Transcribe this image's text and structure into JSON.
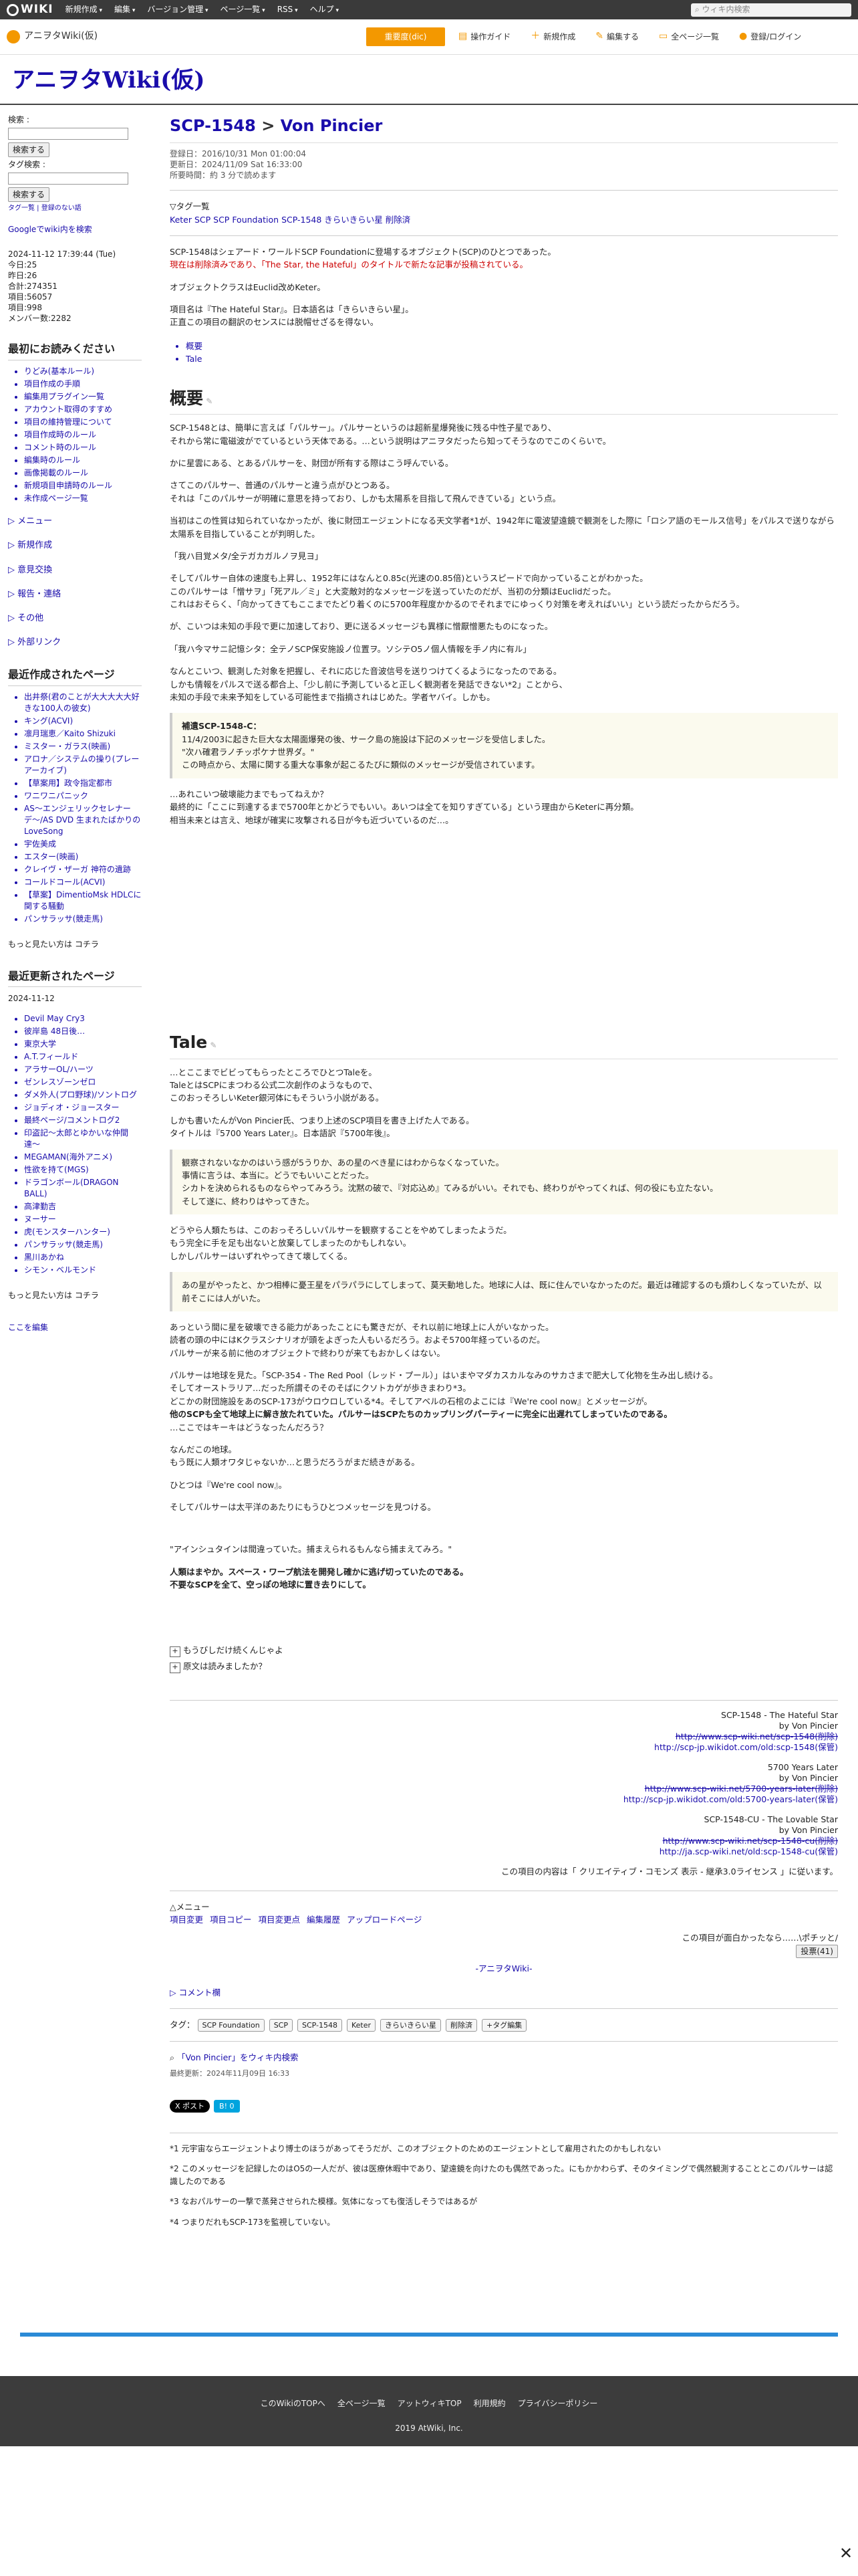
{
  "topbar": {
    "logo": "WIKI",
    "menu": [
      "新規作成",
      "編集",
      "バージョン管理",
      "ページ一覧",
      "RSS",
      "ヘルプ"
    ],
    "search": "ウィキ内検索"
  },
  "toolbar": {
    "site": "アニヲタWiki(仮)",
    "items": [
      "重要度(dic)",
      "操作ガイド",
      "新規作成",
      "編集する",
      "全ページ一覧",
      "登録/ログイン"
    ]
  },
  "site_title": "アニヲタWiki(仮)",
  "left": {
    "search_label": "検索 :",
    "search_btn": "検索する",
    "tag_label": "タグ検索 :",
    "tag_btn": "検索する",
    "tag_links": "タグ一覧 | 登録のない語",
    "google": "Googleでwiki内を検索",
    "stats": [
      "2024-11-12 17:39:44 (Tue)",
      "今日:25",
      "昨日:26",
      "合計:274351",
      "項目:56057",
      "項目:998",
      "メンバー数:2282"
    ],
    "recent_title": "最初にお読みください",
    "recent": [
      "りどみ(基本ルール)",
      "項目作成の手順",
      "編集用プラグイン一覧",
      "アカウント取得のすすめ",
      "項目の維持管理について",
      "項目作成時のルール",
      "コメント時のルール",
      "編集時のルール",
      "画像掲載のルール",
      "新規項目申請時のルール",
      "未作成ページ一覧"
    ],
    "menus": [
      "メニュー",
      "新規作成",
      "意見交換",
      "報告・連絡",
      "その他",
      "外部リンク"
    ],
    "created_title": "最近作成されたページ",
    "created": [
      "出井祭(君のことが大大大大大好きな100人の彼女)",
      "キング(ACVI)",
      "凛月瑞恵／Kaito Shizuki",
      "ミスター・ガラス(映画)",
      "アロナ／システムの操り(プレーアーカイブ)",
      "【草案用】政令指定都市",
      "ワニワニパニック",
      "AS〜エンジェリックセレナーデ〜/AS DVD 生まれたばかりのLoveSong",
      "宇佐美成",
      "エスター(映画)",
      "クレイヴ・ザーガ 神符の遺跡",
      "コールドコール(ACVI)",
      "【草案】DimentioMsk HDLCに関する騒動",
      "パンサラッサ(競走馬)"
    ],
    "more1": "もっと見たい方は コチラ",
    "updated_title": "最近更新されたページ",
    "date": "2024-11-12",
    "updated": [
      "Devil May Cry3",
      "彼岸島 48日後…",
      "東京大学",
      "A.T.フィールド",
      "アラサーOL/ハーツ",
      "ゼンレスゾーンゼロ",
      "ダメ外人(プロ野球)/ソントログ",
      "ジョディオ・ジョースター",
      "最終ページ/コメントログ2",
      "印盗記〜太郎とゆかいな仲間達〜",
      "MEGAMAN(海外アニメ)",
      "性欲を持て(MGS)",
      "ドラゴンボール(DRAGON BALL)",
      "高津勤吉",
      "ヌーサー",
      "虎(モンスターハンター)",
      "パンサラッサ(競走馬)",
      "黒川あかね",
      "シモン・ベルモンド"
    ],
    "more2": "もっと見たい方は コチラ",
    "edit_here": "ここを編集"
  },
  "main": {
    "title_a": "SCP-1548",
    "title_sep": ">",
    "title_b": "Von Pincier",
    "meta": [
      "登録日：2016/10/31 Mon 01:00:04",
      "更新日：2024/11/09 Sat 16:33:00",
      "所要時間：約 3 分で読めます"
    ],
    "tags_label": "▽タグ一覧",
    "tags_line": "Keter SCP SCP Foundation SCP-1548 きらいきらい星 削除済",
    "intro1": "SCP-1548はシェアード・ワールドSCP Foundationに登場するオブジェクト(SCP)のひとつであった。",
    "intro2": "現在は削除済みであり、「The Star, the Hateful」のタイトルで新たな記事が投稿されている。",
    "intro3": "オブジェクトクラスはEuclid改めKeter。",
    "intro4": "項目名は『The Hateful Star』。日本語名は「きらいきらい星」。",
    "intro5": "正直この項目の翻訳のセンスには脱帽せざるを得ない。",
    "toc": [
      "概要",
      "Tale"
    ],
    "h_gaiyou": "概要",
    "g1": "SCP-1548とは、簡単に言えば「パルサー」。パルサーというのは超新星爆発後に残る中性子星であり、",
    "g2": "それから常に電磁波がでているという天体である。…という説明はアニヲタだったら知ってそうなのでこのくらいで。",
    "g3": "かに星雲にある、とあるパルサーを、財団が所有する際はこう呼んでいる。",
    "g4": "さてこのパルサー、普通のパルサーと違う点がひとつある。",
    "g5": "それは「このパルサーが明確に意思を持っており、しかも太陽系を目指して飛んできている」という点。",
    "g6": "当初はこの性質は知られていなかったが、後に財団エージェントになる天文学者*1が、1942年に電波望遠鏡で観測をした際に「ロシア語のモールス信号」をパルスで送りながら太陽系を目指していることが判明した。",
    "g7": "「我ハ目覚メタ/全テガカガルノヲ見ヨ」",
    "g8": "そしてパルサー自体の速度も上昇し、1952年にはなんと0.85c(光速の0.85倍)というスピードで向かっていることがわかった。",
    "g9": "このパルサーは「憎サヲ」「死アル／ミ」と大変敵対的なメッセージを送っていたのだが、当初の分類はEuclidだった。",
    "g10": "これはおそらく、「向かってきてもここまでたどり着くのに5700年程度かかるのでそれまでにゆっくり対策を考えればいい」という読だったからだろう。",
    "g11": "が、こいつは未知の手段で更に加速しており、更に送るメッセージも異様に憎厭憎悪たものになった。",
    "g12": "「我ハ今マサニ記憶シタ：全テノSCP保安施設ノ位置ヲ。ソシテO5ノ個人情報を手ノ内に有ル」",
    "g13": "なんとこいつ、観測した対象を把握し、それに応じた音波信号を送りつけてくるようになったのである。",
    "g14": "しかも情報をパルスで送る都合上、「少し前に予測していると正しく観測者を発話できない*2」ことから、",
    "g15": "未知の手段で未来予知をしている可能性まで指摘されはじめた。学者ヤバイ。しかも。",
    "box_title": "補遺SCP-1548-C：",
    "box1": "11/4/2003に起きた巨大な太陽面爆発の後、サーク島の施設は下記のメッセージを受信しました。",
    "box2": "\"次ハ確君ラノチッポケナ世界ダ。\"",
    "box3": "この時点から、太陽に関する重大な事象が起こるたびに類似のメッセージが受信されています。",
    "g16": "…あれこいつ破壊能力までもってねえか？",
    "g17": "最終的に「ここに到達するまで5700年とかどうでもいい。あいつは全てを知りすぎている」という理由からKeterに再分類。",
    "g18": "相当未来とは言え、地球が確実に攻撃される日が今も近づいているのだ…。",
    "h_tale": "Tale",
    "t1": "…とここまでビビってもらったところでひとつTaleを。",
    "t2": "TaleとはSCPにまつわる公式二次創作のようなもので、",
    "t3": "このおっそろしいKeter銀河体にもそういう小説がある。",
    "t4": "しかも書いたんがVon Pincier氏、つまり上述のSCP項目を書き上げた人である。",
    "t5": "タイトルは『5700 Years Later』。日本語訳『5700年後』。",
    "qb1": "観察されないなかのはいう感が5うりか、あの星のべき星にはわからなくなっていた。",
    "qb2": "事情に言うは、本当に。どうでもいいことだった。",
    "qb3": "シカトを決められるものならやってみろう。沈黙の破で、『対応込め』てみるがいい。それでも、終わりがやってくれば、何の役にも立たない。",
    "qb4": "そして遂に、終わりはやってきた。",
    "t6": "どうやら人類たちは、このおっそろしいパルサーを観察することをやめてしまったようだ。",
    "t7": "もう完全に手を足も出ないと放棄してしまったのかもしれない。",
    "t8": "しかしパルサーはいずれやってきて壊してくる。",
    "qc1": "あの星がやったと、かつ相棒に憂王星をパラパラにしてしまって、莫天動地した。地球に人は、既に住んでいなかったのだ。最近は確認するのも煩わしくなっていたが、以前そこには人がいた。",
    "t9": "あっという間に星を破壊できる能力があったことにも驚きだが、それ以前に地球上に人がいなかった。",
    "t10": "読者の頭の中にはKクラスシナリオが頭をよぎった人もいるだろう。およそ5700年経っているのだ。",
    "t11": "パルサーが来る前に他のオブジェクトで終わりが来てもおかしくはない。",
    "t12": "パルサーは地球を見た。「SCP-354 - The Red Pool（レッド・プール）」はいまやマダカスカルなみのサカさまで肥大して化物を生み出し続ける。",
    "t13": "そしてオーストラリア…だった所謂そのそのそばにクソトカゲが歩きまわり*3。",
    "t14": "どこかの財団施設をあのSCP-173がウロウロしている*4。そしてアベルの石棺のよこには『We're cool now』とメッセージが。",
    "t15": "他のSCPも全て地球上に解き放たれていた。パルサーはSCPたちのカップリングパーティーに完全に出遅れてしまっていたのである。",
    "t16": "…ここではキーキはどうなったんだろう？",
    "t17": "なんだこの地球。",
    "t18": "もう既に人類オワタじゃないか…と思うだろうがまだ続きがある。",
    "t19": "ひとつは『We're cool now』。",
    "t20": "そしてパルサーは太平洋のあたりにもうひとつメッセージを見つける。",
    "t21": "\"アインシュタインは間違っていた。捕まえられるもんなら捕まえてみろ。\"",
    "t22": "人類はまやか。スペース・ワープ航法を開発し確かに逃げ切っていたのである。",
    "t23": "不要なSCPを全て、空っぽの地球に置き去りにして。",
    "folds": [
      "もうびしだけ続くんじゃよ",
      "原文は読みましたか？"
    ],
    "credits": [
      [
        "SCP-1548 - The Hateful Star",
        "by Von Pincier",
        "http://www.scp-wiki.net/scp-1548(削除)",
        "http://scp-jp.wikidot.com/old:scp-1548(保管)"
      ],
      [
        "5700 Years Later",
        "by Von Pincier",
        "http://www.scp-wiki.net/5700-years-later(削除)",
        "http://scp-jp.wikidot.com/old:5700-years-later(保管)"
      ],
      [
        "SCP-1548-CU - The Lovable Star",
        "by Von Pincier",
        "http://www.scp-wiki.net/scp-1548-cu(削除)",
        "http://ja.scp-wiki.net/old:scp-1548-cu(保管)"
      ]
    ],
    "license": "この項目の内容は「 クリエイティブ・コモンズ 表示 - 継承3.0ライセンス 」に従います。",
    "menu2_label": "△メニュー",
    "menu2": [
      "項目変更",
      "項目コピー",
      "項目変更点",
      "編集履歴",
      "アップロードページ"
    ],
    "vote_text": "この項目が面白かったなら……\\ポチッと/",
    "vote_btn": "投票(41)",
    "bottom_site": "-アニヲタWiki-",
    "comment": "▷ コメント欄",
    "tag_label": "タグ：",
    "tags": [
      "SCP Foundation",
      "SCP",
      "SCP-1548",
      "Keter",
      "きらいきらい星",
      "削除済",
      "+タグ編集"
    ],
    "wiki_search": "「Von Pincier」をウィキ内検索",
    "last_updated": "最終更新：2024年11月09日 16:33",
    "x_post": "X ポスト",
    "b_count": "B! 0",
    "footnotes": [
      "*1 元宇宙ならエージェントより博士のほうがあってそうだが、このオブジェクトのためのエージェントとして雇用されたのかもしれない",
      "*2 このメッセージを記録したのはO5の一人だが、彼は医療休暇中であり、望遠鏡を向けたのも偶然であった。にもかかわらず、そのタイミングで偶然観測することとこのパルサーは認識したのである",
      "*3 なおパルサーの一撃で蒸発させられた模様。気体になっても復活しそうではあるが",
      "*4 つまりだれもSCP-173を監視していない。"
    ]
  },
  "footer": {
    "links": [
      "このWikiのTOPへ",
      "全ページ一覧",
      "アットウィキTOP",
      "利用規約",
      "プライバシーポリシー"
    ],
    "copy": "2019 AtWiki, Inc."
  },
  "close": "✕"
}
